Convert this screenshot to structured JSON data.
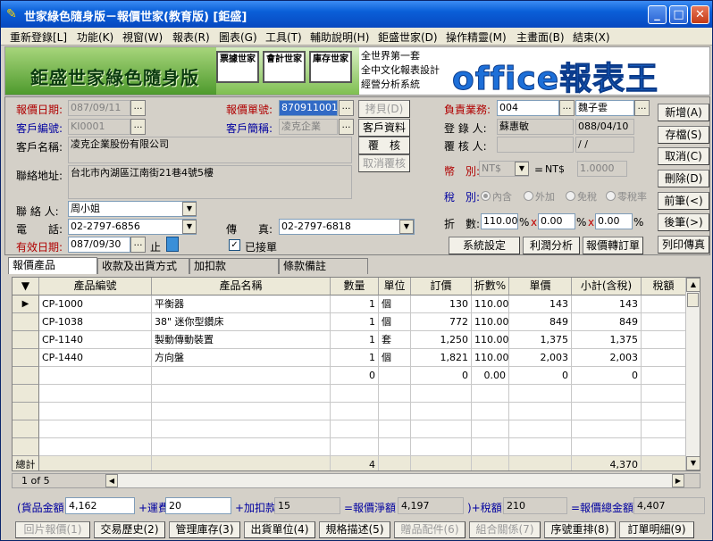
{
  "window": {
    "title": "世家綠色隨身版－報價世家(教育版) [鉅盛]"
  },
  "menu": [
    "重新登錄[L]",
    "功能(K)",
    "視窗(W)",
    "報表(R)",
    "圖表(G)",
    "工具(T)",
    "輔助說明(H)",
    "鉅盛世家(D)",
    "操作精靈(M)",
    "主畫面(B)",
    "結束(X)"
  ],
  "banner": {
    "brand": "鉅盛世家綠色隨身版",
    "panels": [
      "票據世家",
      "會計世家",
      "庫存世家"
    ],
    "tagline": [
      "全世界第一套",
      "全中文化報表設計",
      "經營分析系統"
    ],
    "product": "office報表王"
  },
  "form": {
    "quote_date_label": "報價日期:",
    "quote_date": "087/09/11",
    "customer_code_label": "客戶編號:",
    "customer_code": "KI0001",
    "quote_no_label": "報價單號:",
    "quote_no": "870911001",
    "customer_short_label": "客戶簡稱:",
    "customer_short": "凌克企業",
    "customer_name_label": "客戶名稱:",
    "customer_name": "凌克企業股份有限公司",
    "address_label": "聯絡地址:",
    "address": "台北市內湖區江南街21巷4號5樓",
    "contact_label": "聯 絡 人:",
    "contact": "周小姐",
    "phone_label": "電　　話:",
    "phone": "02-2797-6856",
    "fax_label": "傳　　真:",
    "fax": "02-2797-6818",
    "valid_date_label": "有效日期:",
    "valid_date": "087/09/30",
    "valid_until": "止",
    "received_label": "已接單",
    "copy_btn": "拷貝(D)",
    "customer_info_btn": "客戶資料",
    "review_btn": "覆　核",
    "cancel_review_btn": "取消覆核",
    "salesperson_label": "負責業務:",
    "salesperson_code": "004",
    "salesperson_name": "魏子雲",
    "registrar_label": "登 錄 人:",
    "registrar": "蘇惠敏",
    "register_date": "088/04/10",
    "reviewer_label": "覆 核 人:",
    "review_date": " /  /",
    "currency_label": "幣　別:",
    "currency": "NT$",
    "currency_base": "NT$",
    "exchange_rate": "1.0000",
    "tax_label": "稅　別:",
    "tax_options": [
      "內含",
      "外加",
      "免稅",
      "零稅率"
    ],
    "discount_label": "折　數:",
    "discount1": "110.00",
    "discount2": "0.00",
    "discount3": "0.00",
    "sys_settings_btn": "系統設定",
    "profit_btn": "利潤分析",
    "to_order_btn": "報價轉訂單"
  },
  "side_buttons": [
    "新增(A)",
    "存檔(S)",
    "取消(C)",
    "刪除(D)",
    "前筆(<)",
    "後筆(>)",
    "列印傳真"
  ],
  "tabs": [
    "報價產品",
    "收款及出貨方式",
    "加扣款",
    "條款備註"
  ],
  "grid": {
    "columns": [
      "產品編號",
      "產品名稱",
      "數量",
      "單位",
      "訂價",
      "折數%",
      "單價",
      "小計(含稅)",
      "稅額"
    ],
    "rows": [
      [
        "CP-1000",
        "平衡器",
        "1",
        "個",
        "130",
        "110.00",
        "143",
        "143",
        ""
      ],
      [
        "CP-1038",
        "38\" 迷你型鑽床",
        "1",
        "個",
        "772",
        "110.00",
        "849",
        "849",
        ""
      ],
      [
        "CP-1140",
        "製動傳動裝置",
        "1",
        "套",
        "1,250",
        "110.00",
        "1,375",
        "1,375",
        ""
      ],
      [
        "CP-1440",
        "方向盤",
        "1",
        "個",
        "1,821",
        "110.00",
        "2,003",
        "2,003",
        ""
      ],
      [
        "",
        "",
        "0",
        "",
        "0",
        "0.00",
        "0",
        "0",
        ""
      ]
    ],
    "total_label": "總計",
    "total_qty": "4",
    "total_amount": "4,370",
    "pager": "1 of 5"
  },
  "totals": {
    "goods_label": "(貨品金額",
    "goods": "4,162",
    "freight_label": "+運費",
    "freight": "20",
    "deduct_label": "+加扣款",
    "deduct": "15",
    "net_label": "=報價淨額",
    "net": "4,197",
    "tax_label": ")+稅額",
    "tax": "210",
    "grand_label": "=報價總金額",
    "grand": "4,407"
  },
  "bottom_buttons": [
    "回片報價(1)",
    "交易歷史(2)",
    "管理庫存(3)",
    "出貨單位(4)",
    "規格描述(5)",
    "贈品配件(6)",
    "組合關係(7)",
    "序號重排(8)",
    "訂單明細(9)"
  ],
  "colors": {
    "title_bar": "#0a5fd8",
    "label_red": "#b00000",
    "label_blue": "#0000a0",
    "banner_blue": "#1d6fd8"
  }
}
